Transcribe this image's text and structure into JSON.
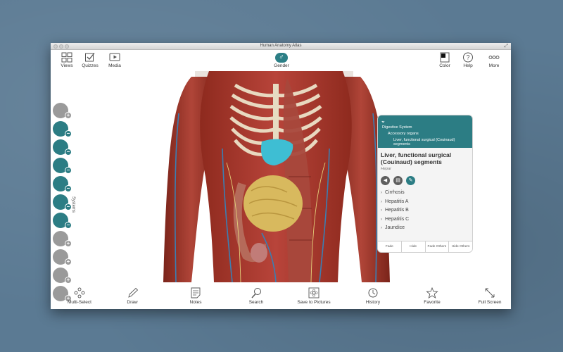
{
  "window": {
    "title": "Human Anatomy Atlas"
  },
  "toolbar_top": {
    "views": "Views",
    "quizzes": "Quizzes",
    "media": "Media",
    "gender": "Gender",
    "color": "Color",
    "help": "Help",
    "more": "More"
  },
  "systems": {
    "label": "Systems",
    "buttons": [
      {
        "icon": "skin-system-icon",
        "state": "+",
        "color": "#9a9a9a"
      },
      {
        "icon": "skeletal-system-icon",
        "state": "−",
        "color": "#2c7d84"
      },
      {
        "icon": "muscular-system-icon",
        "state": "−",
        "color": "#2c7d84"
      },
      {
        "icon": "cardiovascular-system-icon",
        "state": "−",
        "color": "#2c7d84"
      },
      {
        "icon": "respiratory-system-icon",
        "state": "−",
        "color": "#2c7d84"
      },
      {
        "icon": "nervous-system-icon",
        "state": "−",
        "color": "#2c7d84"
      },
      {
        "icon": "digestive-system-icon",
        "state": "−",
        "color": "#2c7d84"
      },
      {
        "icon": "lymphatic-system-icon",
        "state": "+",
        "color": "#9a9a9a"
      },
      {
        "icon": "endocrine-system-icon",
        "state": "+",
        "color": "#9a9a9a"
      },
      {
        "icon": "urinary-system-icon",
        "state": "+",
        "color": "#9a9a9a"
      },
      {
        "icon": "reproductive-system-icon",
        "state": "+",
        "color": "#9a9a9a"
      }
    ]
  },
  "info_panel": {
    "breadcrumbs": [
      "Digestive System",
      "Accessory organs",
      "Liver, functional surgical (Couinaud) segments"
    ],
    "title": "Liver, functional surgical (Couinaud) segments",
    "latin": "Hepar",
    "conditions": [
      "Cirrhosis",
      "Hepatitis A",
      "Hepatitis B",
      "Hepatitis C",
      "Jaundice"
    ],
    "actions": [
      "Fade",
      "Hide",
      "Fade Others",
      "Hide Others"
    ]
  },
  "toolbar_bottom": {
    "multi_select": "Multi-Select",
    "draw": "Draw",
    "notes": "Notes",
    "search": "Search",
    "save_to_pictures": "Save to Pictures",
    "history": "History",
    "favorite": "Favorite",
    "full_screen": "Full Screen"
  },
  "colors": {
    "accent": "#2c7d84",
    "background": "#5b7a93"
  }
}
